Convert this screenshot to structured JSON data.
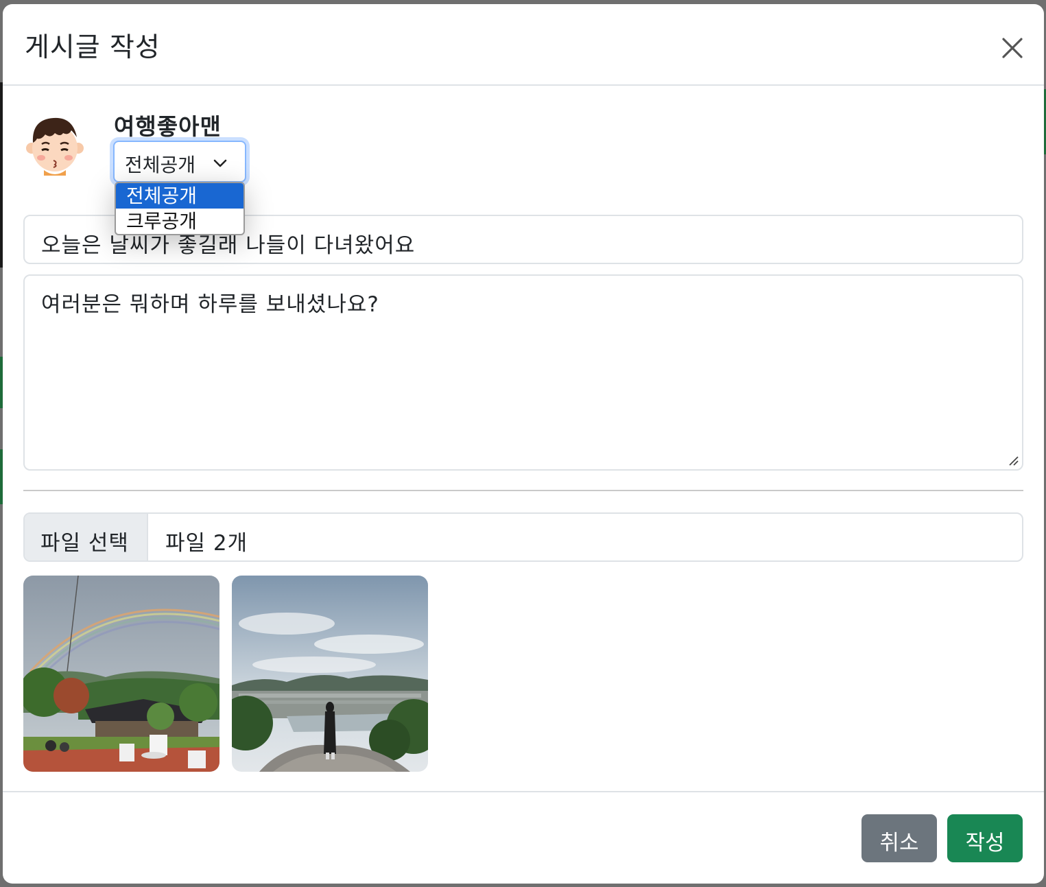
{
  "modal": {
    "title": "게시글 작성",
    "close_icon": "close-icon"
  },
  "author": {
    "username": "여행좋아맨",
    "avatar_icon": "boy-face-avatar"
  },
  "visibility": {
    "selected": "전체공개",
    "options": [
      "전체공개",
      "크루공개"
    ],
    "highlighted_index": 0
  },
  "post": {
    "title_value": "오늘은 날씨가 좋길래 나들이 다녀왔어요",
    "content_value": "여러분은 뭐하며 하루를 보내셨나요?"
  },
  "file": {
    "button_label": "파일 선택",
    "status": "파일 2개"
  },
  "images": [
    {
      "name": "rainbow-garden-photo"
    },
    {
      "name": "hilltop-city-view-photo"
    }
  ],
  "footer": {
    "cancel_label": "취소",
    "submit_label": "작성"
  },
  "colors": {
    "cancel": "#6c757d",
    "submit": "#198754",
    "selected_option": "#1967d2",
    "focus_ring": "#86b7fe"
  }
}
